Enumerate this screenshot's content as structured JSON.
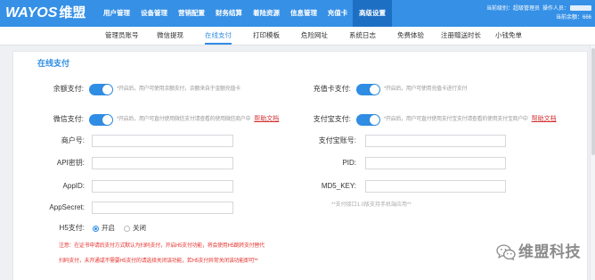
{
  "colors": {
    "accent": "#2f8de4",
    "topbar": "#3590e6",
    "active_menu_bg": "#1d6fc4",
    "warning": "#e53935",
    "link": "#d32f2f",
    "muted": "#9a9a9a",
    "page_bg": "#eef0f3"
  },
  "header": {
    "logo": {
      "text": "WAYOS",
      "cn": "维盟"
    },
    "menu": [
      {
        "label": "用户管理"
      },
      {
        "label": "设备管理"
      },
      {
        "label": "营销配置"
      },
      {
        "label": "财务结算"
      },
      {
        "label": "着陆资源"
      },
      {
        "label": "信息管理"
      },
      {
        "label": "充值卡"
      },
      {
        "label": "高级设置",
        "active": true
      }
    ],
    "user": {
      "level": "当前级别：超级管理员",
      "operator_label": "操作人员：",
      "balance_label": "当前余额：",
      "balance": "666"
    }
  },
  "subnav": {
    "items": [
      {
        "label": "管理员账号"
      },
      {
        "label": "微信提现"
      },
      {
        "label": "在线支付",
        "active": true
      },
      {
        "label": "打印模板"
      },
      {
        "label": "危险网址"
      },
      {
        "label": "系统日志"
      },
      {
        "label": "免费体验"
      },
      {
        "label": "注册赠送时长"
      },
      {
        "label": "小钱免单"
      }
    ]
  },
  "page": {
    "title": "在线支付",
    "switches": {
      "balance": {
        "label": "余额支付:",
        "enabled": true,
        "hint": "*开启后，用户可使用余额支付，余额来自于金额充值卡"
      },
      "recharge_card": {
        "label": "充值卡支付:",
        "enabled": true,
        "hint": "*开启后，用户可使用充值卡进行支付"
      },
      "wechat": {
        "label": "微信支付:",
        "enabled": true,
        "hint": "*开启后，用户可直付使用微信支付请查看的使用微信商户中",
        "help_link": "帮助文档"
      },
      "alipay": {
        "label": "支付宝支付:",
        "enabled": true,
        "hint": "*开启后，用户可直付使用支付宝支付请查看的使用支付宝商户中",
        "help_link": "帮助文档"
      }
    },
    "wechat_fields": [
      {
        "label": "商户号:",
        "value": ""
      },
      {
        "label": "API密钥:",
        "value": ""
      },
      {
        "label": "AppID:",
        "value": ""
      },
      {
        "label": "AppSecret:",
        "value": ""
      }
    ],
    "alipay_fields": [
      {
        "label": "支付宝账号:",
        "value": ""
      },
      {
        "label": "PID:",
        "value": ""
      },
      {
        "label": "MD5_KEY:",
        "value": ""
      }
    ],
    "alipay_note": "**支付接口1.0版支持手机端应用**",
    "h5": {
      "label": "H5支付:",
      "options": [
        "开启",
        "关闭"
      ],
      "selected_index": 0
    },
    "notice": [
      "注意：在证书申请后支付方式默认为扫码支付，开启H5支付功能，将会使用H5跳转支付替代",
      "扫码支付，未开通或不需要H5支付的请选择关闭该功能，若H5支付异常关闭该功能即可**"
    ]
  },
  "watermark": {
    "icon": "wechat-icon",
    "text": "维盟科技"
  }
}
